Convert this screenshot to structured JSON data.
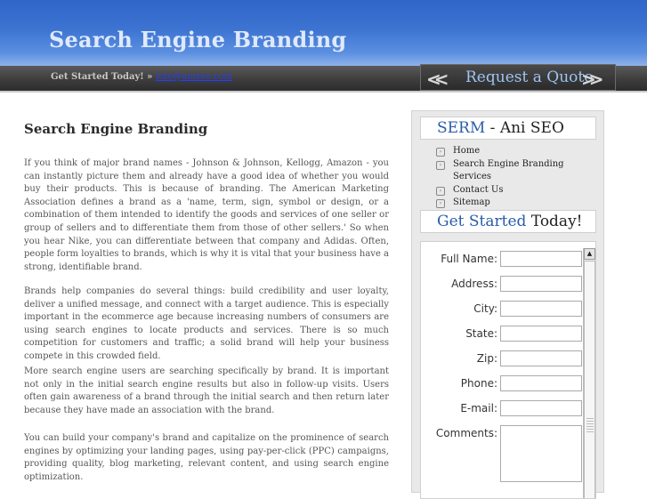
{
  "header": {
    "title": "Search Engine Branding"
  },
  "topbar": {
    "get_started": "Get Started Today! »",
    "email": "info@aniseo.com",
    "quote_label": "Request a Quote",
    "prev_icon": "chevron-left-icon",
    "next_icon": "chevron-right-icon"
  },
  "main": {
    "heading": "Search Engine Branding",
    "paragraphs": [
      "If you think of major brand names - Johnson & Johnson, Kellogg, Amazon - you can instantly picture them and already have a good idea of whether you would buy their products. This is because of branding. The American Marketing Association defines a brand as a 'name, term, sign, symbol or design, or a combination of them intended to identify the goods and services of one seller or group of sellers and to differentiate them from those of other sellers.' So when you hear Nike, you can differentiate between that company and Adidas. Often, people form loyalties to brands, which is why it is vital that your business have a strong, identifiable brand.",
      "Brands help companies do several things: build credibility and user loyalty, deliver a unified message, and connect with a target audience. This is especially important in the ecommerce age because increasing numbers of consumers are using search engines to locate products and services. There is so much competition for customers and traffic; a solid brand will help your business compete in this crowded field.",
      "More search engine users are searching specifically by brand. It is important not only in the initial search engine results but also in follow-up visits. Users often gain awareness of a brand through the initial search and then return later because they have made an association with the brand.",
      "You can build your company's brand and capitalize on the prominence of search engines by optimizing your landing pages, using pay-per-click (PPC) campaigns, providing quality, blog marketing, relevant content, and using search engine optimization."
    ]
  },
  "sidebar": {
    "serm_title_hl": "SERM",
    "serm_title_rest": " - Ani SEO",
    "menu": [
      "Home",
      "Search Engine Branding Services",
      "Contact Us",
      "Sitemap"
    ],
    "get_started_hl": "Get Started",
    "get_started_rest": " Today!",
    "form": {
      "full_name": "Full Name:",
      "address": "Address:",
      "city": "City:",
      "state": "State:",
      "zip": "Zip:",
      "phone": "Phone:",
      "email": "E-mail:",
      "comments": "Comments:"
    }
  },
  "colors": {
    "banner": "#3d74d2",
    "bar": "#3d3d3d",
    "link": "#2a3ef0",
    "accent": "#2a5ca8"
  }
}
